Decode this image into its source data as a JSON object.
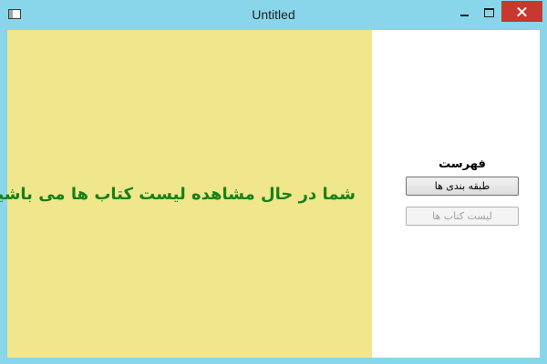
{
  "window": {
    "title": "Untitled",
    "colors": {
      "frame": "#89d6ea",
      "close_button": "#c7392f"
    },
    "controls": {
      "app_icon": "window-app-icon",
      "minimize_icon": "minimize-icon",
      "maximize_icon": "maximize-icon",
      "close_icon": "close-icon"
    }
  },
  "main": {
    "message": "شما در حال مشاهده لیست کتاب ها می باشید",
    "message_color": "#188018",
    "pane_color": "#f0e68c"
  },
  "sidebar": {
    "menu_title": "فهرست",
    "buttons": [
      {
        "label": "طبقه بندی ها",
        "enabled": true
      },
      {
        "label": "لیست کتاب ها",
        "enabled": false
      }
    ]
  }
}
